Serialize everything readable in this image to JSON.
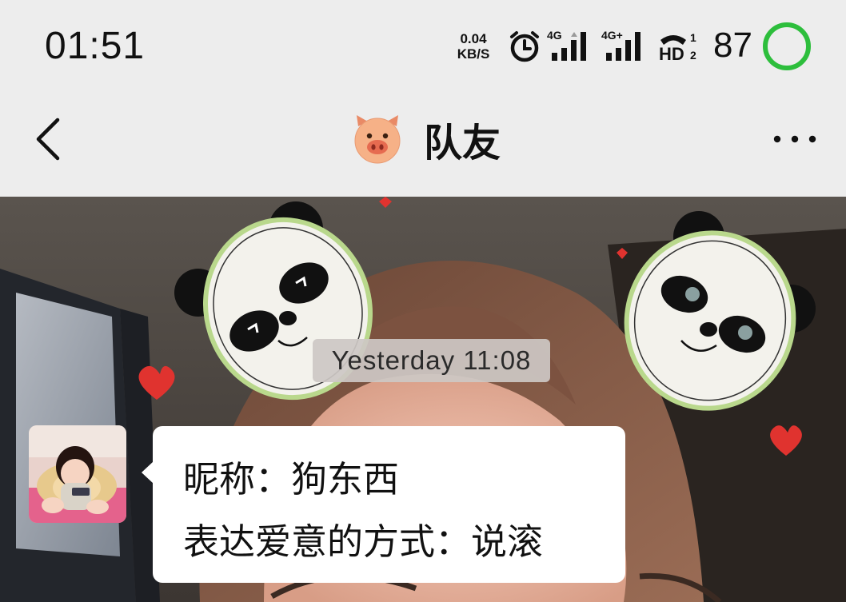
{
  "status_bar": {
    "time": "01:51",
    "net_speed_value": "0.04",
    "net_speed_unit": "KB/S",
    "signal1_label": "4G",
    "signal2_label": "4G+",
    "hd_label": "HD",
    "battery_level": "87",
    "battery_ring_color": "#2dbe3c"
  },
  "title_bar": {
    "title": "队友",
    "title_icon": "pig-face-emoji-icon",
    "back_icon": "chevron-left-icon",
    "more_icon": "more-dots-icon"
  },
  "chat": {
    "timestamp": "Yesterday 11:08",
    "messages": [
      {
        "sender_avatar": "baby-avatar",
        "lines": [
          "昵称：狗东西",
          "表达爱意的方式：说滚"
        ]
      }
    ]
  }
}
